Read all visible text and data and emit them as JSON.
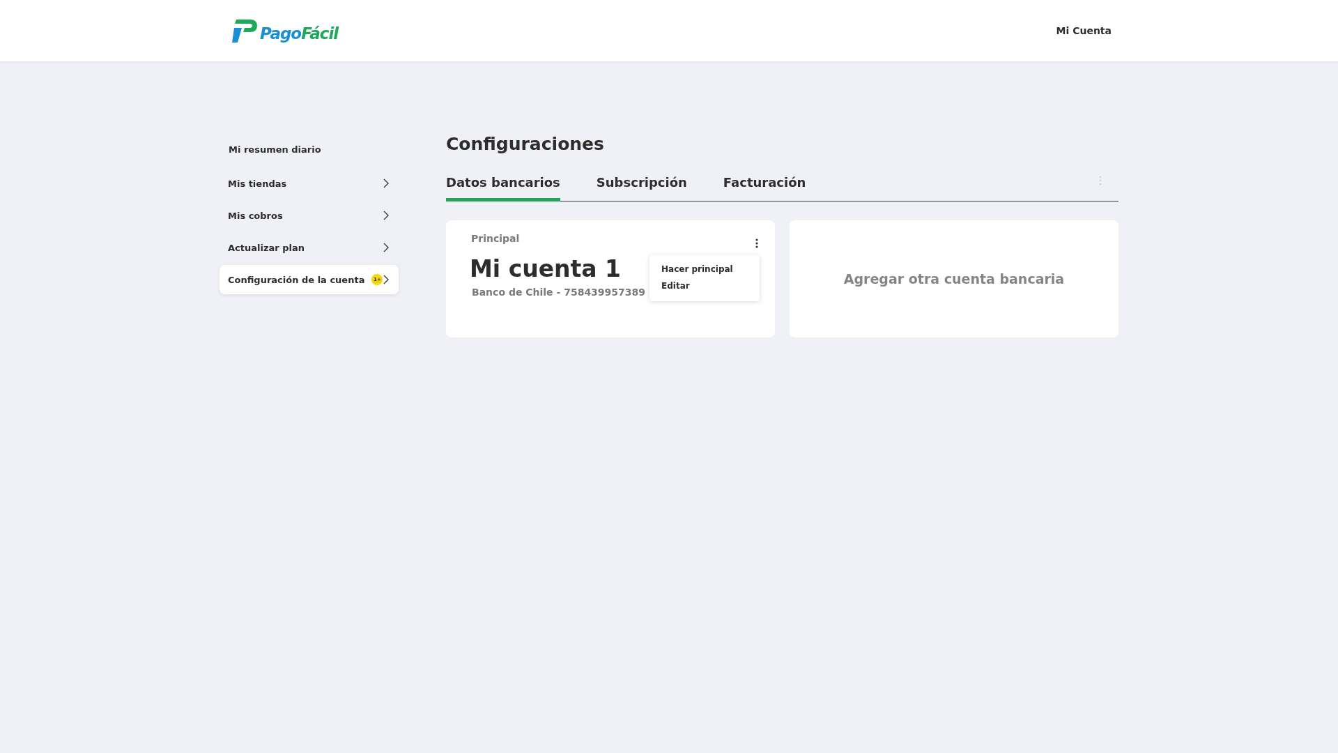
{
  "header": {
    "logo": {
      "part_1": "Pago",
      "part_2": "Fácil"
    },
    "account_link": "Mi Cuenta"
  },
  "sidebar": {
    "items": [
      {
        "label": "Mi resumen diario",
        "kind": "plain",
        "selected": false
      },
      {
        "label": "Mis tiendas",
        "kind": "expandable",
        "selected": false
      },
      {
        "label": "Mis cobros",
        "kind": "expandable",
        "selected": false
      },
      {
        "label": "Actualizar plan",
        "kind": "expandable",
        "selected": false
      },
      {
        "label": "Configuración de la cuenta",
        "kind": "expandable",
        "selected": true,
        "badge": "1+"
      }
    ]
  },
  "page": {
    "title": "Configuraciones",
    "tabs": [
      {
        "label": "Datos bancarios",
        "selected": true
      },
      {
        "label": "Subscripción",
        "selected": false
      },
      {
        "label": "Facturación",
        "selected": false
      }
    ],
    "accounts": [
      {
        "tag": "Principal",
        "name": "Mi cuenta 1",
        "detail": "Banco de Chile - 758439957389",
        "menu": {
          "expanded": true,
          "items": [
            "Hacer principal",
            "Editar"
          ]
        }
      }
    ],
    "add_card": "Agregar otra cuenta bancaria"
  }
}
